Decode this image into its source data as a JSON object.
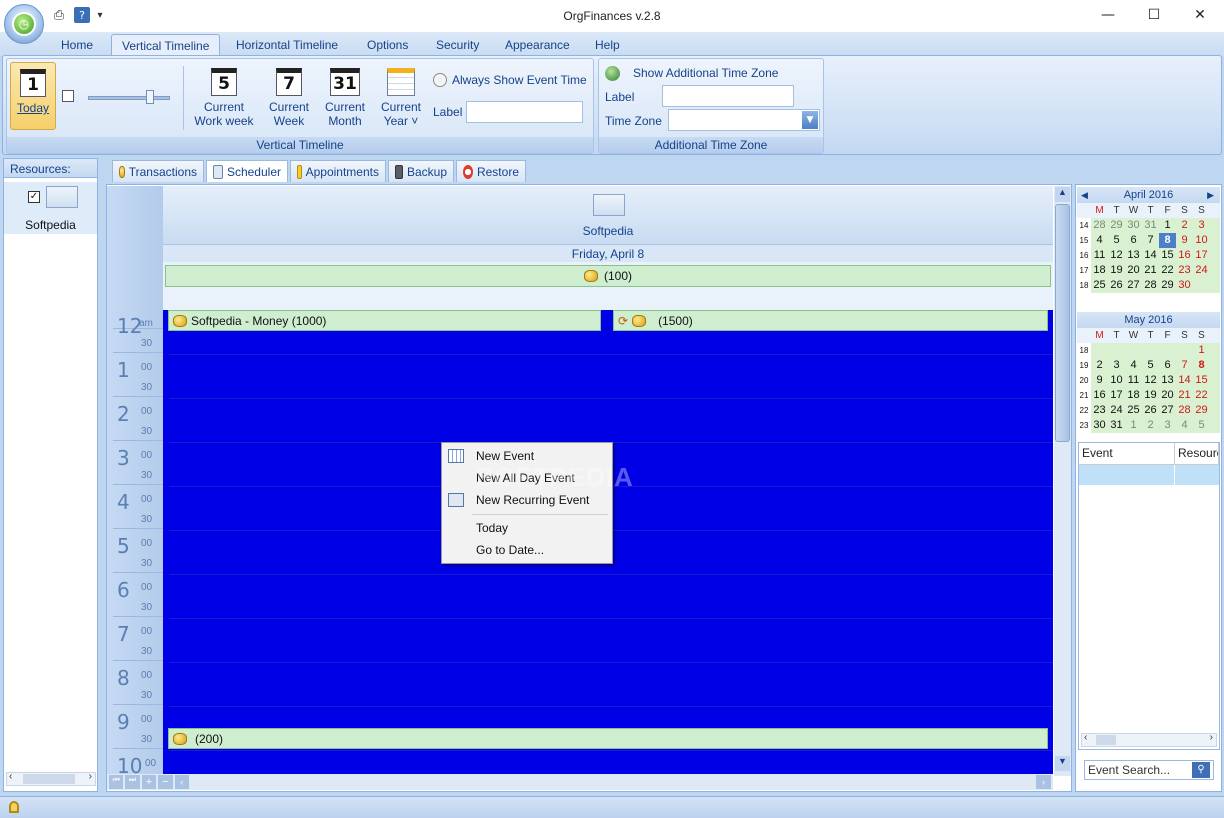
{
  "window": {
    "title": "OrgFinances v.2.8",
    "minimize": "—",
    "maximize": "☐",
    "close": "✕"
  },
  "qat": {
    "print_icon": "printer-icon",
    "help_icon": "help-icon",
    "dropdown": "▾"
  },
  "ribbon_tabs": [
    "Home",
    "Vertical Timeline",
    "Horizontal Timeline",
    "Options",
    "Security",
    "Appearance",
    "Help"
  ],
  "ribbon": {
    "today_num": "1",
    "today_label": "Today",
    "work_week_num": "5",
    "work_week_label1": "Current",
    "work_week_label2": "Work week",
    "week_num": "7",
    "week_label1": "Current",
    "week_label2": "Week",
    "month_num": "31",
    "month_label1": "Current",
    "month_label2": "Month",
    "year_label1": "Current",
    "year_label2": "Year ˅",
    "always_show": "Always Show Event Time",
    "label_caption": "Label",
    "group1": "Vertical Timeline",
    "show_additional": "Show Additional Time Zone",
    "tz_label_caption": "Label",
    "tz_caption": "Time Zone",
    "group2": "Additional Time Zone"
  },
  "resources": {
    "header": "Resources:",
    "item": "Softpedia"
  },
  "doc_tabs": [
    "Transactions",
    "Scheduler",
    "Appointments",
    "Backup",
    "Restore"
  ],
  "scheduler": {
    "resource_name": "Softpedia",
    "date": "Friday, April 8",
    "allday_event": "(100)",
    "event1": "Softpedia - Money (1000)",
    "event2": "(1500)",
    "event3": "(200)",
    "hours": [
      "12",
      "1",
      "2",
      "3",
      "4",
      "5",
      "6",
      "7",
      "8",
      "9",
      "10"
    ],
    "first_suffix": "am",
    "min00": "00",
    "min30": "30"
  },
  "calendar_april": {
    "title": "April 2016",
    "dows": [
      "M",
      "T",
      "W",
      "T",
      "F",
      "S",
      "S"
    ],
    "weeks": [
      [
        "14",
        "28",
        "29",
        "30",
        "31",
        "1",
        "2",
        "3"
      ],
      [
        "15",
        "4",
        "5",
        "6",
        "7",
        "8",
        "9",
        "10"
      ],
      [
        "16",
        "11",
        "12",
        "13",
        "14",
        "15",
        "16",
        "17"
      ],
      [
        "17",
        "18",
        "19",
        "20",
        "21",
        "22",
        "23",
        "24"
      ],
      [
        "18",
        "25",
        "26",
        "27",
        "28",
        "29",
        "30",
        ""
      ]
    ]
  },
  "calendar_may": {
    "title": "May 2016",
    "dows": [
      "M",
      "T",
      "W",
      "T",
      "F",
      "S",
      "S"
    ],
    "weeks": [
      [
        "18",
        "",
        "",
        "",
        "",
        "",
        "",
        "1"
      ],
      [
        "19",
        "2",
        "3",
        "4",
        "5",
        "6",
        "7",
        "8"
      ],
      [
        "20",
        "9",
        "10",
        "11",
        "12",
        "13",
        "14",
        "15"
      ],
      [
        "21",
        "16",
        "17",
        "18",
        "19",
        "20",
        "21",
        "22"
      ],
      [
        "22",
        "23",
        "24",
        "25",
        "26",
        "27",
        "28",
        "29"
      ],
      [
        "23",
        "30",
        "31",
        "1",
        "2",
        "3",
        "4",
        "5"
      ]
    ]
  },
  "event_list": {
    "col1": "Event",
    "col2": "Resource"
  },
  "event_search": "Event Search...",
  "context_menu": [
    "New Event",
    "New All Day Event",
    "New Recurring Event",
    "Today",
    "Go to Date..."
  ],
  "watermark": "SOFTPEDIA"
}
